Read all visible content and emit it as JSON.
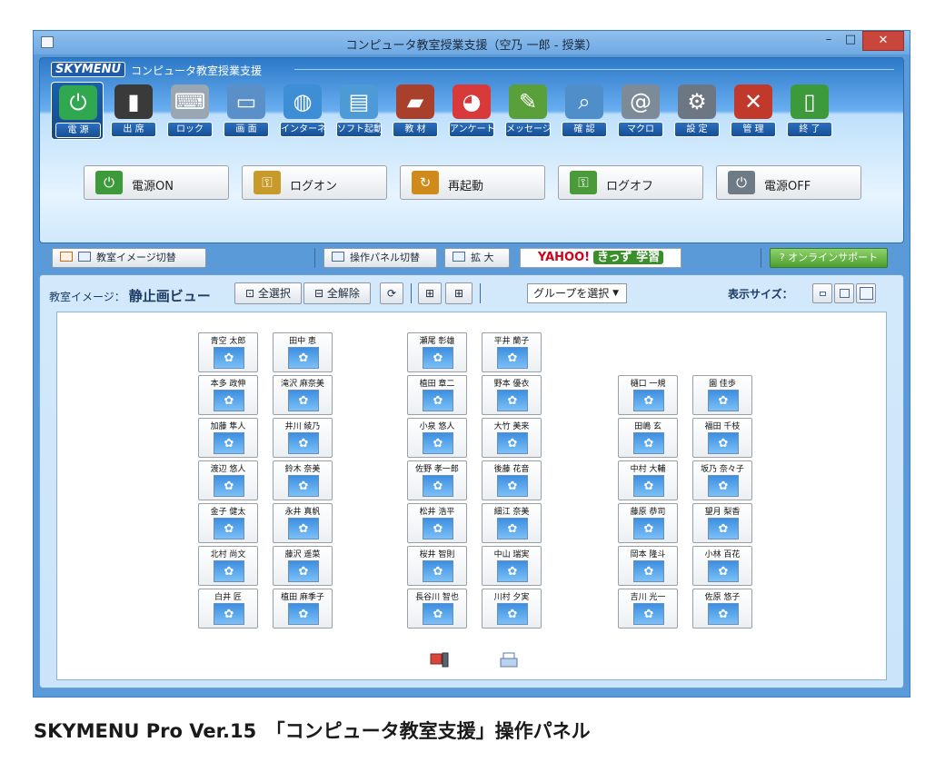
{
  "window": {
    "title": "コンピュータ教室授業支援（空乃 一郎 - 授業）",
    "min_label": "–",
    "max_label": "□",
    "close_label": "✕"
  },
  "header": {
    "logo": "SKYMENU",
    "app_title": "コンピュータ教室授業支援"
  },
  "toolbar": [
    {
      "label": "電 源",
      "icon": "power-icon",
      "glyph": "⏻",
      "color": "#2fa84f"
    },
    {
      "label": "出 席",
      "icon": "book-icon",
      "glyph": "▮",
      "color": "#3a3a3a"
    },
    {
      "label": "ロック",
      "icon": "keyboard-icon",
      "glyph": "⌨",
      "color": "#9aa6b2"
    },
    {
      "label": "画 面",
      "icon": "monitor-icon",
      "glyph": "▭",
      "color": "#5a8fc8"
    },
    {
      "label": "インターネット",
      "icon": "globe-icon",
      "glyph": "◍",
      "color": "#3e8ed6"
    },
    {
      "label": "ソフト起動",
      "icon": "window-icon",
      "glyph": "▤",
      "color": "#4d9ad6"
    },
    {
      "label": "教 材",
      "icon": "textbook-icon",
      "glyph": "▰",
      "color": "#a8402c"
    },
    {
      "label": "アンケート",
      "icon": "pie-chart-icon",
      "glyph": "◕",
      "color": "#d83a3a"
    },
    {
      "label": "メッセージ",
      "icon": "pen-icon",
      "glyph": "✎",
      "color": "#5aa03a"
    },
    {
      "label": "確 認",
      "icon": "magnifier-icon",
      "glyph": "⌕",
      "color": "#4f8ec8"
    },
    {
      "label": "マクロ",
      "icon": "at-icon",
      "glyph": "@",
      "color": "#7d8a98"
    },
    {
      "label": "設 定",
      "icon": "gear-icon",
      "glyph": "⚙",
      "color": "#6d7783"
    },
    {
      "label": "管 理",
      "icon": "wrench-icon",
      "glyph": "✕",
      "color": "#c0392b"
    },
    {
      "label": "終 了",
      "icon": "door-icon",
      "glyph": "▯",
      "color": "#3d9a3a"
    }
  ],
  "actions": [
    {
      "label": "電源ON",
      "icon": "power-on-icon",
      "glyph": "⏻",
      "color": "#3d9a3a"
    },
    {
      "label": "ログオン",
      "icon": "key-icon",
      "glyph": "⚿",
      "color": "#c89a2a"
    },
    {
      "label": "再起動",
      "icon": "restart-icon",
      "glyph": "↻",
      "color": "#d08a1a"
    },
    {
      "label": "ログオフ",
      "icon": "logoff-icon",
      "glyph": "⚿",
      "color": "#4a9a3a"
    },
    {
      "label": "電源OFF",
      "icon": "power-off-icon",
      "glyph": "⏻",
      "color": "#6e7a86"
    }
  ],
  "strip": {
    "switch_image": "教室イメージ切替",
    "switch_panel": "操作パネル切替",
    "zoom": "拡 大",
    "yahoo": "YAHOO!",
    "yahoo_sub": "きっず 学習",
    "support": "オンラインサポート"
  },
  "view": {
    "label": "教室イメージ：",
    "mode": "静止画ビュー",
    "select_all": "全選択",
    "deselect_all": "全解除",
    "group_select": "グループを選択",
    "size_label": "表示サイズ："
  },
  "students": [
    "青空 太郎",
    "田中 恵",
    "瀬尾 彰雄",
    "平井 蘭子",
    "本多 政伸",
    "滝沢 麻奈美",
    "植田 章二",
    "野本 優衣",
    "樋口 一規",
    "園 佳歩",
    "加藤 隼人",
    "井川 綾乃",
    "小泉 悠人",
    "大竹 美来",
    "田嶋 玄",
    "福田 千枝",
    "渡辺 悠人",
    "鈴木 奈美",
    "佐野 孝一郎",
    "後藤 花音",
    "中村 大輔",
    "坂乃 奈々子",
    "金子 健太",
    "永井 真帆",
    "松井 浩平",
    "細江 奈美",
    "藤原 恭司",
    "望月 梨香",
    "北村 尚文",
    "藤沢 遥菜",
    "桜井 智則",
    "中山 瑞実",
    "岡本 隆斗",
    "小林 百花",
    "白井 匠",
    "植田 麻季子",
    "長谷川 智也",
    "川村 夕実",
    "吉川 光一",
    "佐原 悠子"
  ],
  "caption": "SKYMENU Pro Ver.15　「コンピュータ教室支援」操作パネル"
}
